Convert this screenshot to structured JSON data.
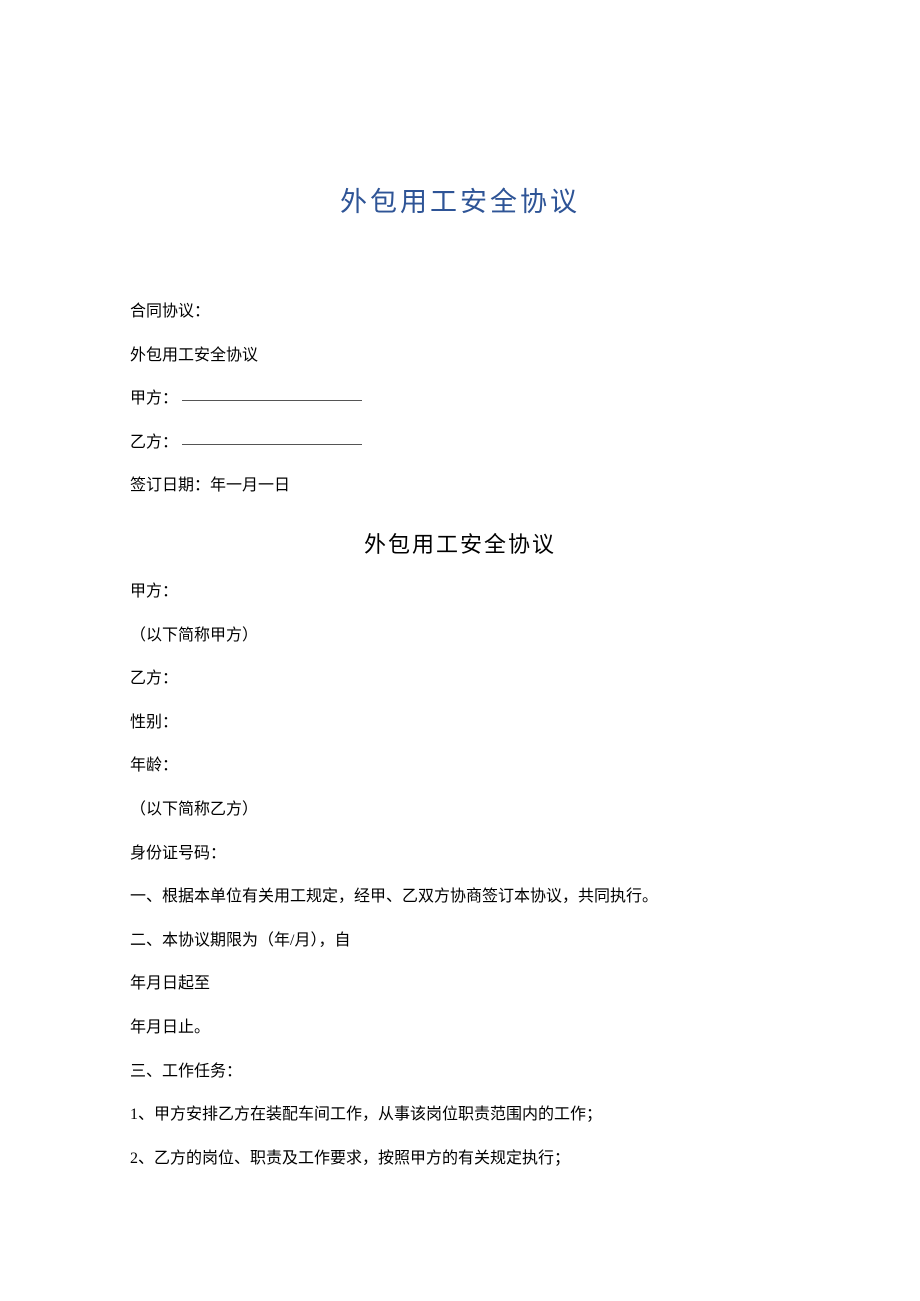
{
  "title_main": "外包用工安全协议",
  "header": {
    "contract_label": "合同协议：",
    "contract_name": "外包用工安全协议",
    "party_a_label": "甲方：",
    "party_b_label": "乙方：",
    "sign_date_label": "签订日期：年一月一日"
  },
  "title_sub": "外包用工安全协议",
  "body": {
    "party_a_label": "甲方：",
    "party_a_note": "（以下简称甲方）",
    "party_b_label": "乙方：",
    "gender_label": "性别：",
    "age_label": "年龄：",
    "party_b_note": "（以下简称乙方）",
    "id_label": "身份证号码：",
    "clause_1": "一、根据本单位有关用工规定，经甲、乙双方协商签订本协议，共同执行。",
    "clause_2": "二、本协议期限为（年/月），自",
    "clause_2_start": "年月日起至",
    "clause_2_end": "年月日止。",
    "clause_3": "三、工作任务：",
    "clause_3_1": "1、甲方安排乙方在装配车间工作，从事该岗位职责范围内的工作；",
    "clause_3_2": "2、乙方的岗位、职责及工作要求，按照甲方的有关规定执行；"
  }
}
